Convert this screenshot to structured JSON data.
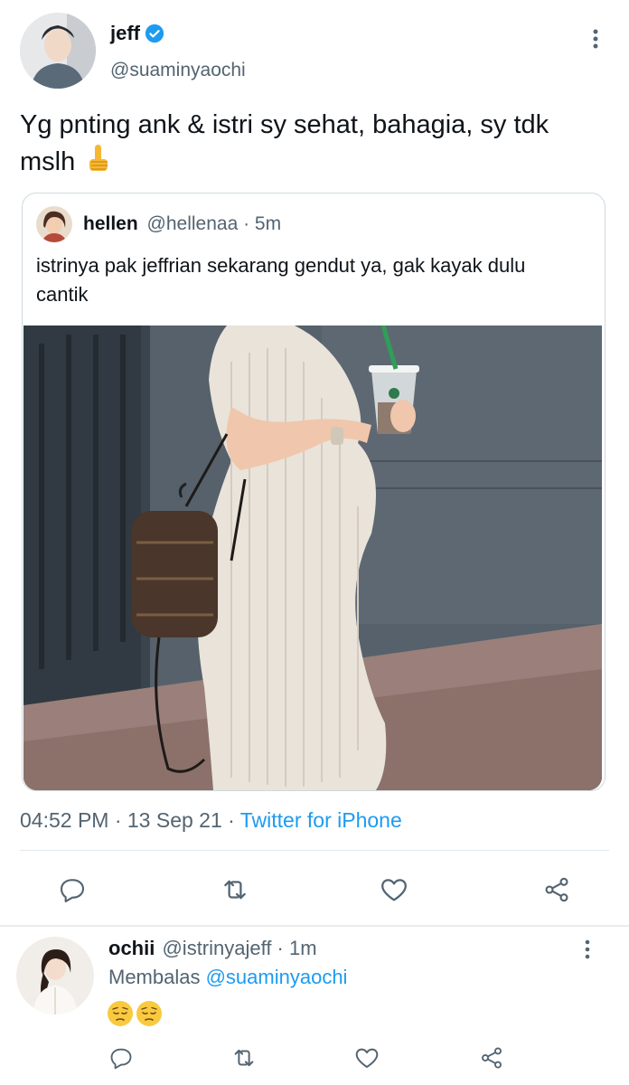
{
  "main_tweet": {
    "author_name": "jeff",
    "handle": "@suaminyaochi",
    "text": "Yg pnting ank & istri sy sehat, bahagia, sy tdk mslh",
    "emoji": "thumbs-up",
    "timestamp": "04:52 PM · 13 Sep 21 · ",
    "source": "Twitter for iPhone"
  },
  "quoted_tweet": {
    "author_name": "hellen",
    "handle": "@hellenaa · 5m",
    "text": "istrinya pak jeffrian sekarang gendut ya, gak kayak dulu cantik",
    "photo_icon": "photo-pregnant-woman"
  },
  "reply": {
    "author_name": "ochii",
    "handle": "@istrinyajeff · 1m",
    "replying_prefix": "Membalas ",
    "replying_to": "@suaminyaochi",
    "emojis": [
      "pensive-face",
      "pensive-face"
    ]
  },
  "icons": {
    "reply": "reply-icon",
    "retweet": "retweet-icon",
    "like": "heart-icon",
    "share": "share-icon",
    "more": "more-icon",
    "verified": "verified-badge-icon"
  },
  "colors": {
    "accent": "#1d9bf0",
    "muted": "#536471",
    "text": "#0f1419"
  }
}
